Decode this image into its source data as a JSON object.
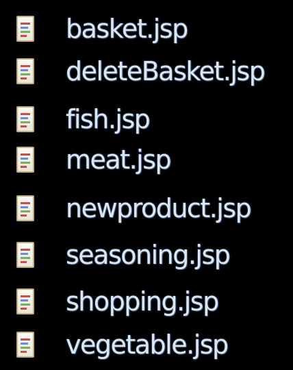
{
  "files": [
    {
      "name": "basket.jsp",
      "icon": "jsp-file-icon"
    },
    {
      "name": "deleteBasket.jsp",
      "icon": "jsp-file-icon"
    },
    {
      "name": "fish.jsp",
      "icon": "jsp-file-icon"
    },
    {
      "name": "meat.jsp",
      "icon": "jsp-file-icon"
    },
    {
      "name": "newproduct.jsp",
      "icon": "jsp-file-icon"
    },
    {
      "name": "seasoning.jsp",
      "icon": "jsp-file-icon"
    },
    {
      "name": "shopping.jsp",
      "icon": "jsp-file-icon"
    },
    {
      "name": "vegetable.jsp",
      "icon": "jsp-file-icon"
    }
  ],
  "colors": {
    "background": "#000000",
    "text": "#dbe7f2",
    "icon_border": "#c3ad7c"
  }
}
